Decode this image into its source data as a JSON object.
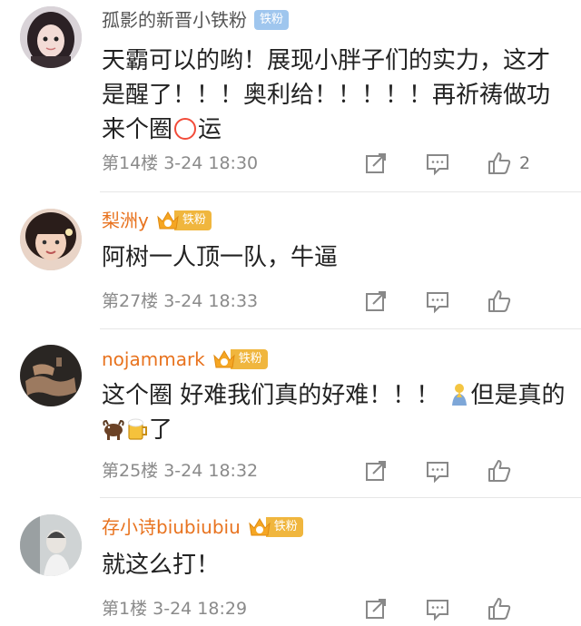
{
  "comments": [
    {
      "username": "孤影的新晋小铁粉",
      "badge_label": "铁粉",
      "badge_style": "blue",
      "content_parts": [
        "天霸可以的哟！展现小胖子们的实力，这才是醒了！！！奥利给！！！！！再祈祷做功来个圈",
        "运"
      ],
      "floor_time": "第14楼 3-24 18:30",
      "like_count": "2",
      "avatar_icon": "avatar-girl-icon"
    },
    {
      "username": "梨洲y",
      "badge_label": "铁粉",
      "badge_style": "gold",
      "content_parts": [
        "阿树一人顶一队，牛逼"
      ],
      "floor_time": "第27楼 3-24 18:33",
      "like_count": "",
      "avatar_icon": "avatar-woman-icon"
    },
    {
      "username": "nojammark",
      "badge_label": "铁粉",
      "badge_style": "gold",
      "content_parts": [
        "这个圈 好难我们真的好难！！！",
        "但是真的",
        "了"
      ],
      "floor_time": "第25楼 3-24 18:32",
      "like_count": "",
      "avatar_icon": "avatar-hands-icon"
    },
    {
      "username": "存小诗biubiubiu",
      "badge_label": "铁粉",
      "badge_style": "gold",
      "content_parts": [
        "就这么打！"
      ],
      "floor_time": "第1楼 3-24 18:29",
      "like_count": "",
      "avatar_icon": "avatar-photo-icon"
    }
  ],
  "colors": {
    "accent_orange": "#e8731f",
    "badge_blue": "#9fc6ee",
    "badge_gold": "#f0b63e",
    "meta_grey": "#8a8a8a",
    "ring_red": "#f24b39"
  },
  "icons": {
    "repost": "repost-icon",
    "comment": "comment-icon",
    "like": "thumbs-up-icon"
  }
}
